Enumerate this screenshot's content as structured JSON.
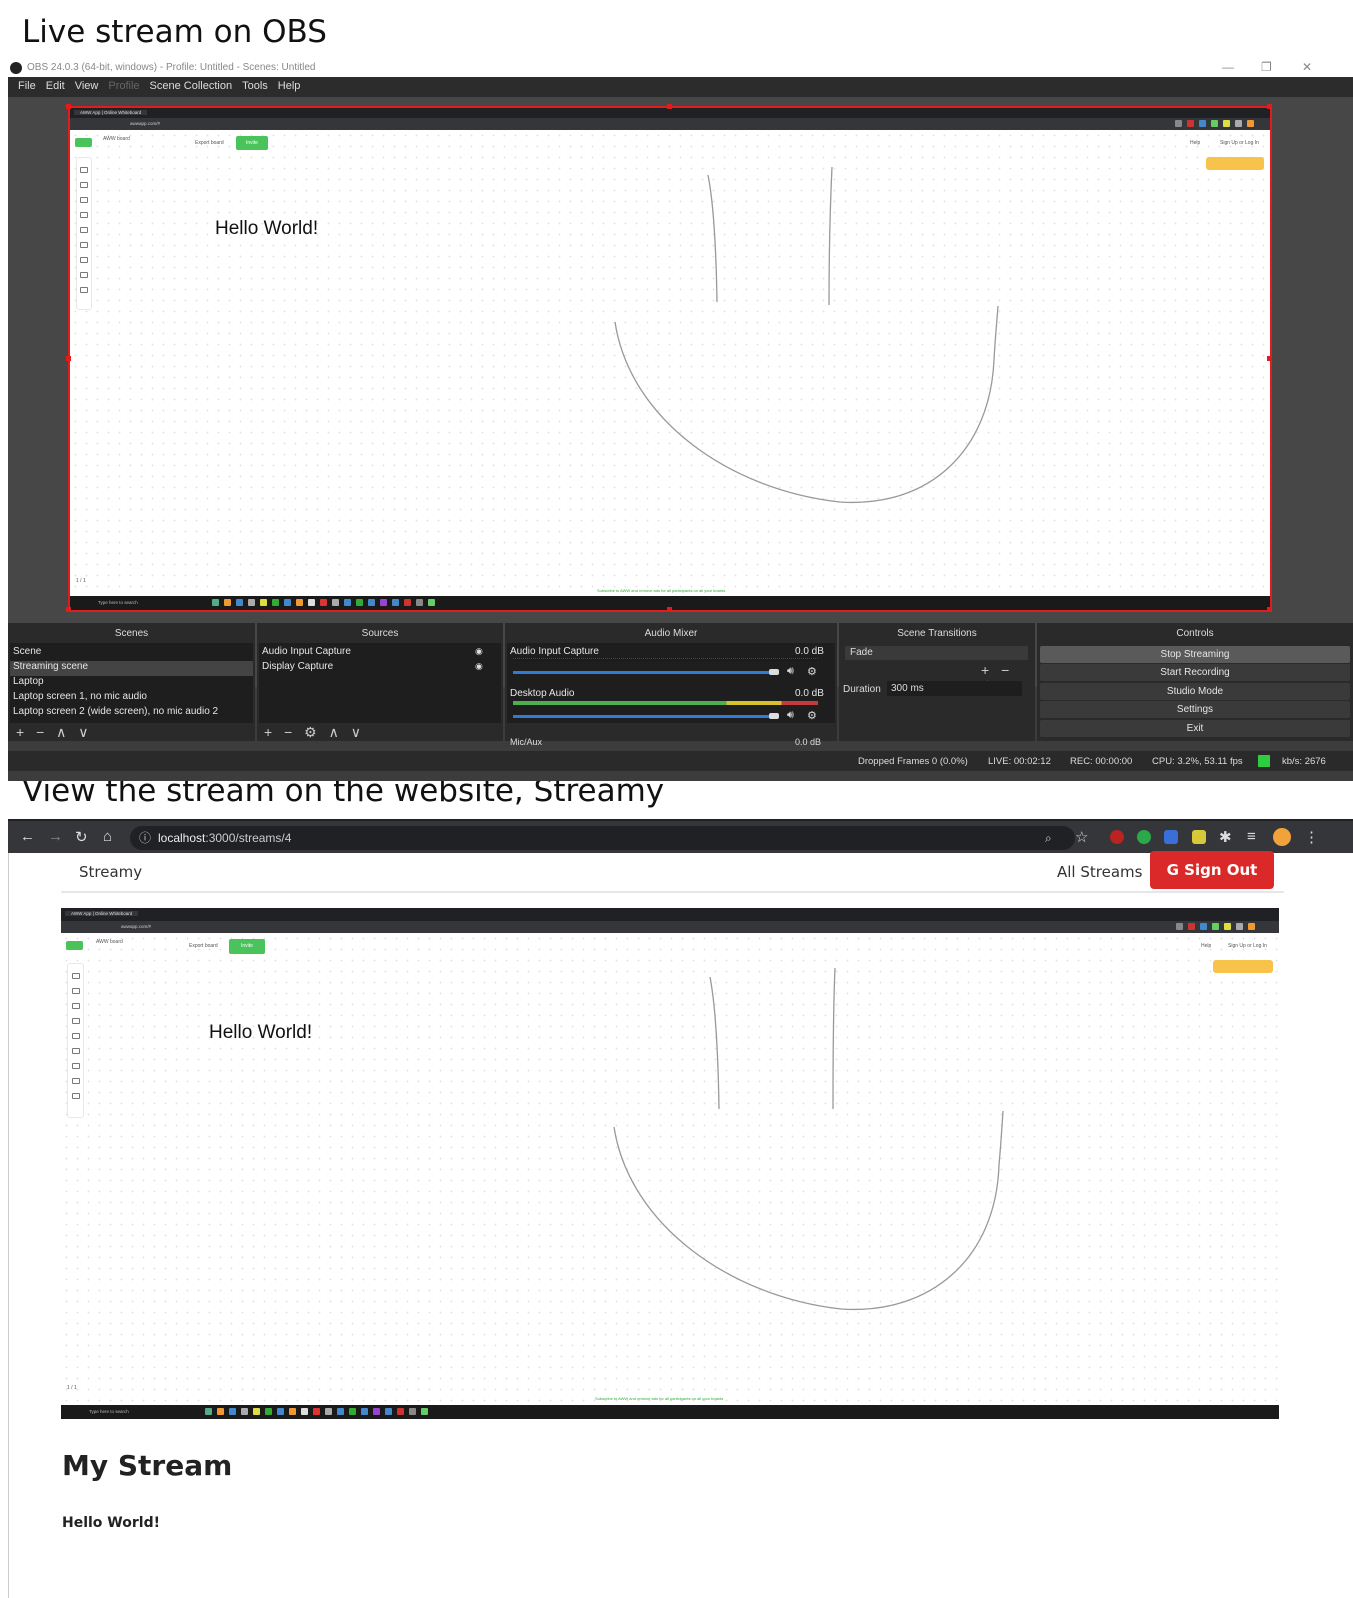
{
  "captions": {
    "top": "Live stream on OBS",
    "bottom": "View the stream on the website, Streamy"
  },
  "obs": {
    "window_title": "OBS 24.0.3 (64-bit, windows) - Profile: Untitled - Scenes: Untitled",
    "menu": [
      "File",
      "Edit",
      "View",
      "Profile",
      "Scene Collection",
      "Tools",
      "Help"
    ],
    "docks": {
      "scenes": {
        "title": "Scenes",
        "items": [
          "Scene",
          "Streaming scene",
          "Laptop",
          "Laptop screen 1, no mic audio",
          "Laptop screen 2 (wide screen), no mic audio 2"
        ],
        "selected_index": 1
      },
      "sources": {
        "title": "Sources",
        "items": [
          "Audio Input Capture",
          "Display Capture"
        ]
      },
      "audio_mixer": {
        "title": "Audio Mixer",
        "channels": [
          {
            "name": "Audio Input Capture",
            "level": "0.0 dB"
          },
          {
            "name": "Desktop Audio",
            "level": "0.0 dB"
          },
          {
            "name": "Mic/Aux",
            "level": "0.0 dB"
          }
        ]
      },
      "transitions": {
        "title": "Scene Transitions",
        "transition": "Fade",
        "duration_label": "Duration",
        "duration_value": "300 ms"
      },
      "controls": {
        "title": "Controls",
        "buttons": [
          "Stop Streaming",
          "Start Recording",
          "Studio Mode",
          "Settings",
          "Exit"
        ]
      }
    },
    "status": {
      "dropped": "Dropped Frames 0 (0.0%)",
      "live": "LIVE: 00:02:12",
      "rec": "REC: 00:00:00",
      "cpu": "CPU: 3.2%, 53.11 fps",
      "kbs": "kb/s: 2676"
    }
  },
  "whiteboard": {
    "tab": "AWW App | Online Whiteboard",
    "url": "awwapp.com/#",
    "board_name": "AWW board",
    "export_label": "Export board",
    "invite_label": "Invite",
    "help_label": "Help",
    "signup_label": "Sign Up or Log In",
    "canvas_text": "Hello World!",
    "page_indicator": "1 / 1",
    "ad_text": "Subscribe to AWW and remove ads for all participants on all your boards",
    "taskbar_search": "Type here to search"
  },
  "browser": {
    "url_host": "localhost",
    "url_path": ":3000/streams/4"
  },
  "streamy": {
    "brand": "Streamy",
    "all_streams": "All Streams",
    "sign_out": "Sign Out",
    "stream_title": "My Stream",
    "stream_description": "Hello World!"
  },
  "colors": {
    "obs_bg": "#3c3c3c",
    "preview_border": "#e31b1b",
    "sign_out_red": "#db2828",
    "invite_green": "#49c35a"
  }
}
